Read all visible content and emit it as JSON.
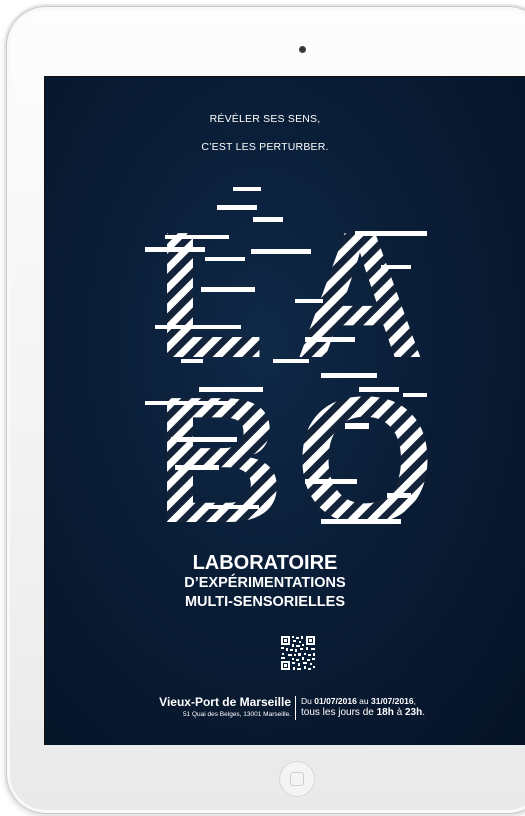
{
  "poster": {
    "tagline_1": "RÉVÉLER SES SENS,",
    "tagline_2": "C’EST LES PERTURBER.",
    "hero_letters": [
      "L",
      "A",
      "B",
      "O"
    ],
    "title_1": "LABORATOIRE",
    "title_2": "D’EXPÉRIMENTATIONS",
    "title_3": "MULTI-SENSORIELLES",
    "venue_name": "Vieux-Port de Marseille",
    "venue_address": "51 Quai des Belges, 13001 Marseille.",
    "dates_prefix": "Du",
    "date_start": "01/07/2016",
    "dates_middle": "au",
    "date_end": "31/07/2016",
    "dates_end_punct": ",",
    "hours_prefix": "tous les jours de",
    "hours_start": "18h",
    "hours_middle": "à",
    "hours_end": "23h",
    "hours_end_punct": "."
  },
  "colors": {
    "background": "#0a1d36",
    "text": "#ffffff",
    "device_frame": "#f2f2f2"
  },
  "icons": [
    "camera-icon",
    "qr-code-icon",
    "home-button-icon"
  ]
}
